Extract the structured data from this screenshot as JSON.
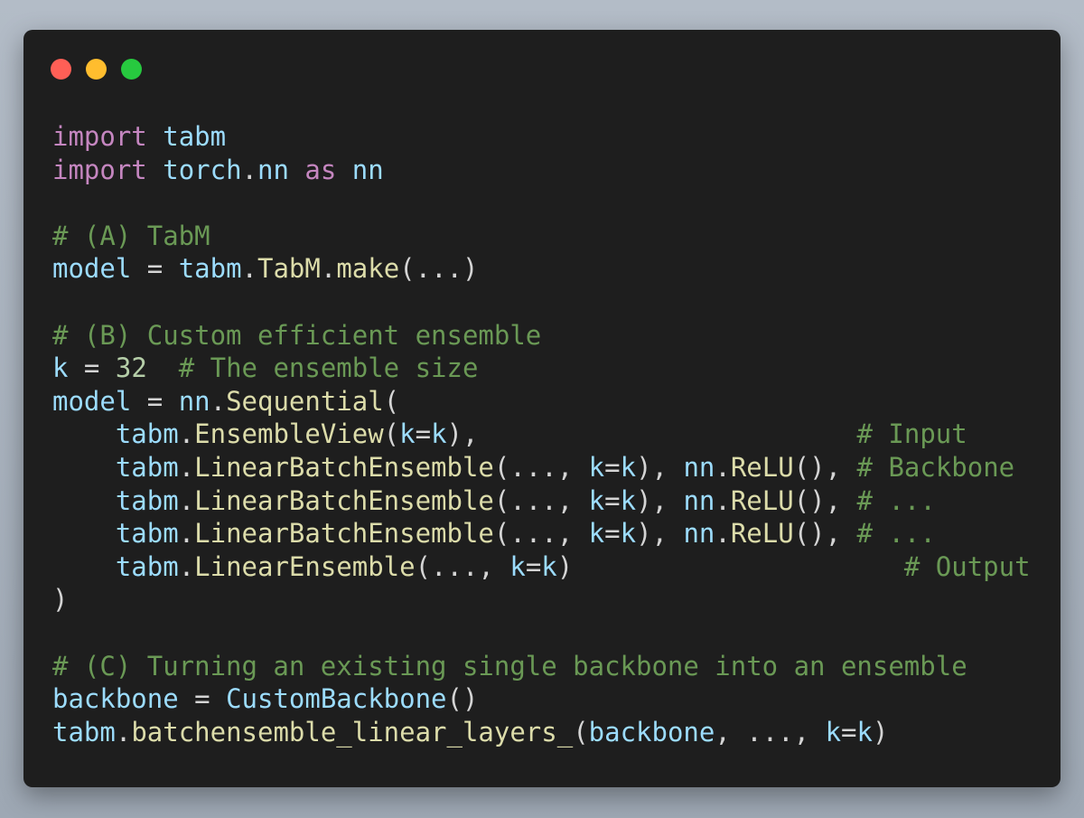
{
  "window": {
    "controls": [
      {
        "name": "close",
        "color": "#ff5f56"
      },
      {
        "name": "minimize",
        "color": "#ffbd2e"
      },
      {
        "name": "zoom",
        "color": "#27c93f"
      }
    ]
  },
  "code": {
    "lines": [
      [
        {
          "t": "import",
          "c": "kw"
        },
        {
          "t": " ",
          "c": "pl"
        },
        {
          "t": "tabm",
          "c": "id"
        }
      ],
      [
        {
          "t": "import",
          "c": "kw"
        },
        {
          "t": " ",
          "c": "pl"
        },
        {
          "t": "torch",
          "c": "id"
        },
        {
          "t": ".",
          "c": "pl"
        },
        {
          "t": "nn",
          "c": "id"
        },
        {
          "t": " ",
          "c": "pl"
        },
        {
          "t": "as",
          "c": "kw"
        },
        {
          "t": " ",
          "c": "pl"
        },
        {
          "t": "nn",
          "c": "id"
        }
      ],
      [],
      [
        {
          "t": "# (A) TabM",
          "c": "cm"
        }
      ],
      [
        {
          "t": "model",
          "c": "id"
        },
        {
          "t": " = ",
          "c": "pl"
        },
        {
          "t": "tabm",
          "c": "id"
        },
        {
          "t": ".",
          "c": "pl"
        },
        {
          "t": "TabM",
          "c": "fn"
        },
        {
          "t": ".",
          "c": "pl"
        },
        {
          "t": "make",
          "c": "fn"
        },
        {
          "t": "(...)",
          "c": "pl"
        }
      ],
      [],
      [
        {
          "t": "# (B) Custom efficient ensemble",
          "c": "cm"
        }
      ],
      [
        {
          "t": "k",
          "c": "id"
        },
        {
          "t": " = ",
          "c": "pl"
        },
        {
          "t": "32",
          "c": "num"
        },
        {
          "t": "  ",
          "c": "pl"
        },
        {
          "t": "# The ensemble size",
          "c": "cm"
        }
      ],
      [
        {
          "t": "model",
          "c": "id"
        },
        {
          "t": " = ",
          "c": "pl"
        },
        {
          "t": "nn",
          "c": "id"
        },
        {
          "t": ".",
          "c": "pl"
        },
        {
          "t": "Sequential",
          "c": "fn"
        },
        {
          "t": "(",
          "c": "pl"
        }
      ],
      [
        {
          "t": "    ",
          "c": "pl"
        },
        {
          "t": "tabm",
          "c": "id"
        },
        {
          "t": ".",
          "c": "pl"
        },
        {
          "t": "EnsembleView",
          "c": "fn"
        },
        {
          "t": "(",
          "c": "pl"
        },
        {
          "t": "k",
          "c": "id"
        },
        {
          "t": "=",
          "c": "pl"
        },
        {
          "t": "k",
          "c": "id"
        },
        {
          "t": "),                        ",
          "c": "pl"
        },
        {
          "t": "# Input",
          "c": "cm"
        }
      ],
      [
        {
          "t": "    ",
          "c": "pl"
        },
        {
          "t": "tabm",
          "c": "id"
        },
        {
          "t": ".",
          "c": "pl"
        },
        {
          "t": "LinearBatchEnsemble",
          "c": "fn"
        },
        {
          "t": "(..., ",
          "c": "pl"
        },
        {
          "t": "k",
          "c": "id"
        },
        {
          "t": "=",
          "c": "pl"
        },
        {
          "t": "k",
          "c": "id"
        },
        {
          "t": "), ",
          "c": "pl"
        },
        {
          "t": "nn",
          "c": "id"
        },
        {
          "t": ".",
          "c": "pl"
        },
        {
          "t": "ReLU",
          "c": "fn"
        },
        {
          "t": "(), ",
          "c": "pl"
        },
        {
          "t": "# Backbone",
          "c": "cm"
        }
      ],
      [
        {
          "t": "    ",
          "c": "pl"
        },
        {
          "t": "tabm",
          "c": "id"
        },
        {
          "t": ".",
          "c": "pl"
        },
        {
          "t": "LinearBatchEnsemble",
          "c": "fn"
        },
        {
          "t": "(..., ",
          "c": "pl"
        },
        {
          "t": "k",
          "c": "id"
        },
        {
          "t": "=",
          "c": "pl"
        },
        {
          "t": "k",
          "c": "id"
        },
        {
          "t": "), ",
          "c": "pl"
        },
        {
          "t": "nn",
          "c": "id"
        },
        {
          "t": ".",
          "c": "pl"
        },
        {
          "t": "ReLU",
          "c": "fn"
        },
        {
          "t": "(), ",
          "c": "pl"
        },
        {
          "t": "# ...",
          "c": "cm"
        }
      ],
      [
        {
          "t": "    ",
          "c": "pl"
        },
        {
          "t": "tabm",
          "c": "id"
        },
        {
          "t": ".",
          "c": "pl"
        },
        {
          "t": "LinearBatchEnsemble",
          "c": "fn"
        },
        {
          "t": "(..., ",
          "c": "pl"
        },
        {
          "t": "k",
          "c": "id"
        },
        {
          "t": "=",
          "c": "pl"
        },
        {
          "t": "k",
          "c": "id"
        },
        {
          "t": "), ",
          "c": "pl"
        },
        {
          "t": "nn",
          "c": "id"
        },
        {
          "t": ".",
          "c": "pl"
        },
        {
          "t": "ReLU",
          "c": "fn"
        },
        {
          "t": "(), ",
          "c": "pl"
        },
        {
          "t": "# ...",
          "c": "cm"
        }
      ],
      [
        {
          "t": "    ",
          "c": "pl"
        },
        {
          "t": "tabm",
          "c": "id"
        },
        {
          "t": ".",
          "c": "pl"
        },
        {
          "t": "LinearEnsemble",
          "c": "fn"
        },
        {
          "t": "(..., ",
          "c": "pl"
        },
        {
          "t": "k",
          "c": "id"
        },
        {
          "t": "=",
          "c": "pl"
        },
        {
          "t": "k",
          "c": "id"
        },
        {
          "t": ")                     ",
          "c": "pl"
        },
        {
          "t": "# Output",
          "c": "cm"
        }
      ],
      [
        {
          "t": ")",
          "c": "pl"
        }
      ],
      [],
      [
        {
          "t": "# (C) Turning an existing single backbone into an ensemble",
          "c": "cm"
        }
      ],
      [
        {
          "t": "backbone",
          "c": "id"
        },
        {
          "t": " = ",
          "c": "pl"
        },
        {
          "t": "CustomBackbone",
          "c": "id"
        },
        {
          "t": "()",
          "c": "pl"
        }
      ],
      [
        {
          "t": "tabm",
          "c": "id"
        },
        {
          "t": ".",
          "c": "pl"
        },
        {
          "t": "batchensemble_linear_layers_",
          "c": "fn"
        },
        {
          "t": "(",
          "c": "pl"
        },
        {
          "t": "backbone",
          "c": "id"
        },
        {
          "t": ", ..., ",
          "c": "pl"
        },
        {
          "t": "k",
          "c": "id"
        },
        {
          "t": "=",
          "c": "pl"
        },
        {
          "t": "k",
          "c": "id"
        },
        {
          "t": ")",
          "c": "pl"
        }
      ]
    ]
  }
}
